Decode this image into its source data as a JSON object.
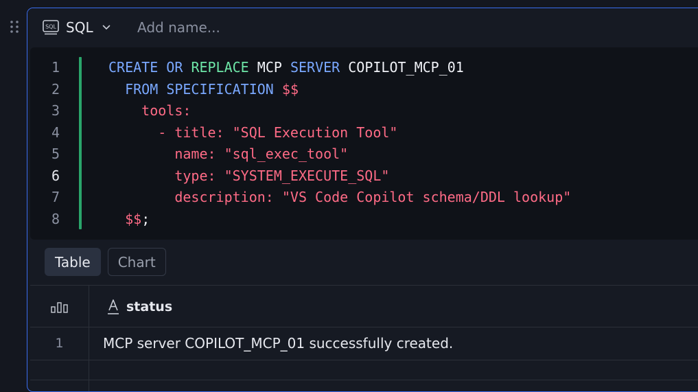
{
  "cell": {
    "language": "SQL",
    "name_placeholder": "Add name...",
    "name_value": "",
    "icons": {
      "drag": "drag-handle-icon",
      "language": "sql-icon",
      "dropdown": "chevron-down-icon"
    }
  },
  "editor": {
    "active_line": 6,
    "lines": [
      {
        "num": "1",
        "tokens": [
          [
            "kw",
            "CREATE"
          ],
          [
            "id",
            " "
          ],
          [
            "kw",
            "OR"
          ],
          [
            "id",
            " "
          ],
          [
            "kw2",
            "REPLACE"
          ],
          [
            "id",
            " "
          ],
          [
            "id",
            "MCP"
          ],
          [
            "id",
            " "
          ],
          [
            "kw",
            "SERVER"
          ],
          [
            "id",
            " "
          ],
          [
            "id",
            "COPILOT_MCP_01"
          ]
        ]
      },
      {
        "num": "2",
        "tokens": [
          [
            "id",
            "  "
          ],
          [
            "kw",
            "FROM"
          ],
          [
            "id",
            " "
          ],
          [
            "kw",
            "SPECIFICATION"
          ],
          [
            "id",
            " "
          ],
          [
            "str",
            "$$"
          ]
        ]
      },
      {
        "num": "3",
        "tokens": [
          [
            "str",
            "    tools:"
          ]
        ]
      },
      {
        "num": "4",
        "tokens": [
          [
            "str",
            "      - title: \"SQL Execution Tool\""
          ]
        ]
      },
      {
        "num": "5",
        "tokens": [
          [
            "str",
            "        name: \"sql_exec_tool\""
          ]
        ]
      },
      {
        "num": "6",
        "tokens": [
          [
            "str",
            "        type: \"SYSTEM_EXECUTE_SQL\""
          ]
        ]
      },
      {
        "num": "7",
        "tokens": [
          [
            "str",
            "        description: \"VS Code Copilot schema/DDL lookup\""
          ]
        ]
      },
      {
        "num": "8",
        "tokens": [
          [
            "id",
            "  "
          ],
          [
            "str",
            "$$"
          ],
          [
            "punct",
            ";"
          ]
        ]
      }
    ]
  },
  "result_tabs": [
    {
      "label": "Table",
      "active": true
    },
    {
      "label": "Chart",
      "active": false
    }
  ],
  "results": {
    "stats_icon": "column-stats-icon",
    "columns": [
      {
        "type_icon": "text-type-icon",
        "name": "status"
      }
    ],
    "rows": [
      {
        "index": "1",
        "status": "MCP server COPILOT_MCP_01 successfully created."
      }
    ]
  },
  "colors": {
    "accent_border": "#3a6df0",
    "gutter_marker": "#2aa56a",
    "keyword": "#7aa8ff",
    "keyword_alt": "#6ee7a8",
    "string": "#ff6b86"
  }
}
